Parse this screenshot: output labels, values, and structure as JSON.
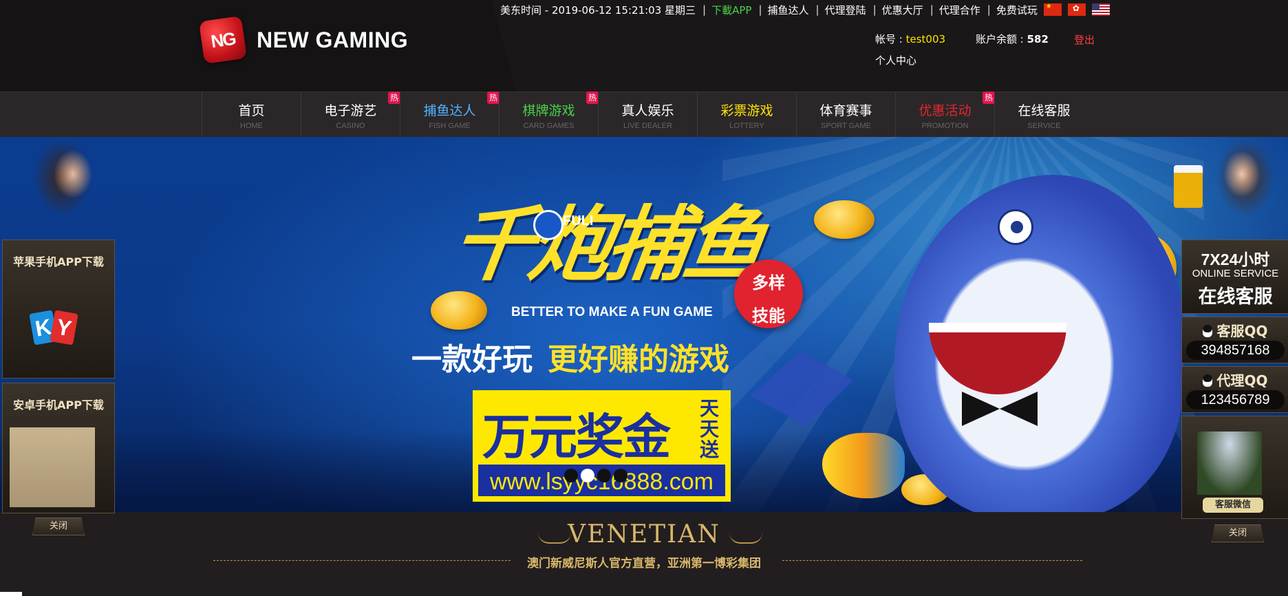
{
  "colors": {
    "header_bg": "#1a1718",
    "nav_bg": "#2b2728",
    "accent_yellow": "#ffe400",
    "logout_red": "#ff3b3b",
    "download_green": "#49d249",
    "hot_badge": "#e3154e",
    "gold": "#d8b66a"
  },
  "topbar": {
    "datetime": "美东时间 - 2019-06-12 15:21:03 星期三",
    "links": [
      "下載APP",
      "捕鱼达人",
      "代理登陆",
      "优惠大厅",
      "代理合作",
      "免费试玩"
    ],
    "flags": [
      "flag-cn-icon",
      "flag-hk-icon",
      "flag-us-icon"
    ]
  },
  "logo": {
    "dice_text": "NG",
    "text": "NEW GAMING"
  },
  "account": {
    "user_label": "帐号 : ",
    "user_value": "test003",
    "balance_label": "账户余额 : ",
    "balance_value": "582",
    "logout": "登出",
    "center": "个人中心"
  },
  "nav": {
    "items": [
      {
        "cn": "首页",
        "en": "HOME",
        "color": "#ffffff",
        "hot": false
      },
      {
        "cn": "电子游艺",
        "en": "CASINO",
        "color": "#ffffff",
        "hot": true
      },
      {
        "cn": "捕鱼达人",
        "en": "FISH GAME",
        "color": "#4fb3ff",
        "hot": true
      },
      {
        "cn": "棋牌游戏",
        "en": "CARD GAMES",
        "color": "#49d249",
        "hot": true
      },
      {
        "cn": "真人娱乐",
        "en": "LIVE DEALER",
        "color": "#ffffff",
        "hot": false
      },
      {
        "cn": "彩票游戏",
        "en": "LOTTERY",
        "color": "#ffe400",
        "hot": false
      },
      {
        "cn": "体育赛事",
        "en": "SPORT GAME",
        "color": "#ffffff",
        "hot": false
      },
      {
        "cn": "优惠活动",
        "en": "PROMOTION",
        "color": "#e3272f",
        "hot": true
      },
      {
        "cn": "在线客服",
        "en": "SERVICE",
        "color": "#ffffff",
        "hot": false
      }
    ],
    "hot_label": "热"
  },
  "banner": {
    "headline": "千炮捕鱼",
    "brand": "FULI",
    "tagline_en": "BETTER TO MAKE A FUN GAME",
    "skill_badge": [
      "多样",
      "技能"
    ],
    "tagline_cn_a": "一款好玩",
    "tagline_cn_b": "更好赚的游戏",
    "prize_main": "万元奖金",
    "prize_side": "天天送",
    "prize_url": "www.lsyyc16888.com",
    "slides": 4,
    "active_slide": 2
  },
  "left_panel": {
    "ios_title": "苹果手机APP下载",
    "android_title": "安卓手机APP下载",
    "ky_letters": [
      "K",
      "Y"
    ],
    "close": "关闭"
  },
  "right_panel": {
    "svc_l1": "7X24小时",
    "svc_l2": "ONLINE SERVICE",
    "svc_l3": "在线客服",
    "qq1_title": "客服QQ",
    "qq1_num": "394857168",
    "qq2_title": "代理QQ",
    "qq2_num": "123456789",
    "wechat_label": "客服微信",
    "close": "关闭"
  },
  "venetian": {
    "title": "VENETIAN",
    "subtitle": "澳门新威尼斯人官方直营，亚洲第一博彩集团"
  }
}
